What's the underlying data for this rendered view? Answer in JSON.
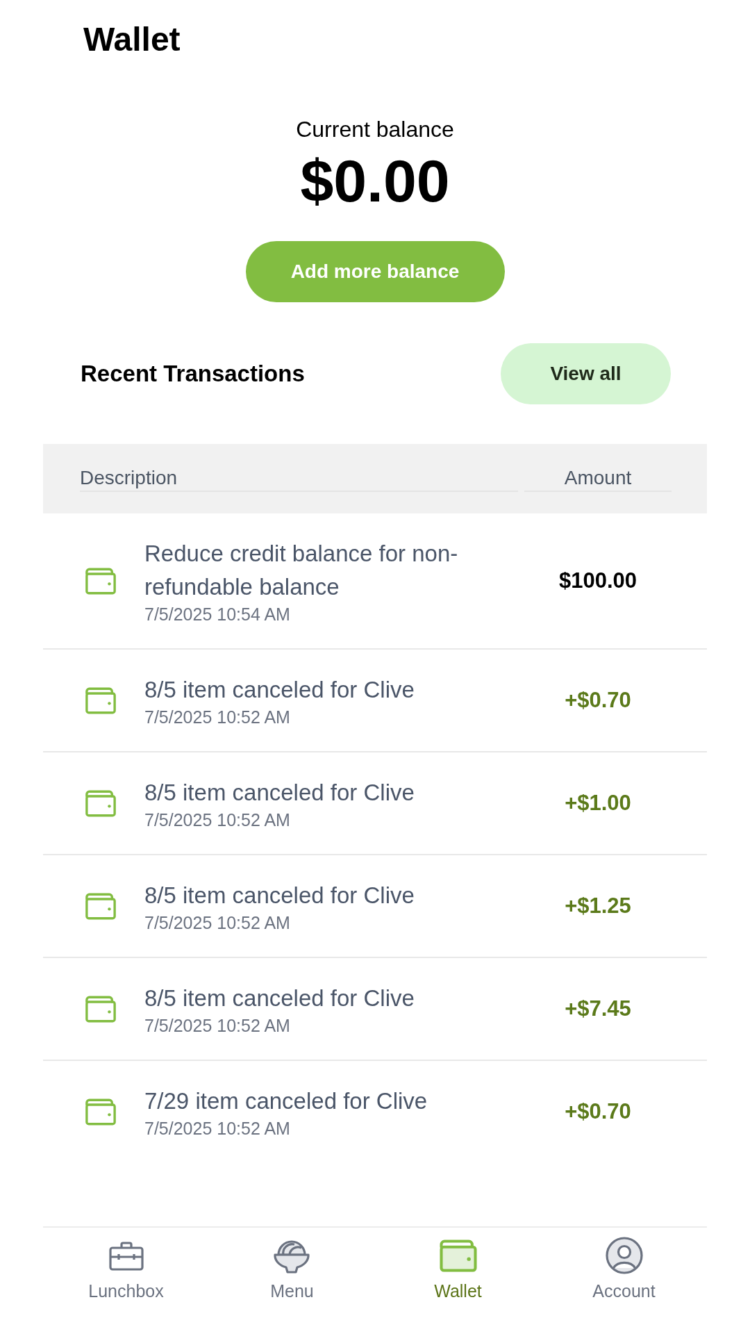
{
  "header": {
    "title": "Wallet"
  },
  "balance": {
    "label": "Current balance",
    "amount": "$0.00",
    "button": "Add more balance"
  },
  "transactions": {
    "title": "Recent Transactions",
    "view_all": "View all",
    "columns": [
      "Description",
      "Amount"
    ],
    "rows": [
      {
        "description": "Reduce credit balance for non-refundable balance",
        "date": "7/5/2025 10:54 AM",
        "amount": "$100.00",
        "kind": "debit"
      },
      {
        "description": "8/5 item canceled for Clive",
        "date": "7/5/2025 10:52 AM",
        "amount": "+$0.70",
        "kind": "credit"
      },
      {
        "description": "8/5 item canceled for Clive",
        "date": "7/5/2025 10:52 AM",
        "amount": "+$1.00",
        "kind": "credit"
      },
      {
        "description": "8/5 item canceled for Clive",
        "date": "7/5/2025 10:52 AM",
        "amount": "+$1.25",
        "kind": "credit"
      },
      {
        "description": "8/5 item canceled for Clive",
        "date": "7/5/2025 10:52 AM",
        "amount": "+$7.45",
        "kind": "credit"
      },
      {
        "description": "7/29 item canceled for Clive",
        "date": "7/5/2025 10:52 AM",
        "amount": "+$0.70",
        "kind": "credit"
      }
    ]
  },
  "nav": [
    {
      "label": "Lunchbox",
      "selected": false
    },
    {
      "label": "Menu",
      "selected": false
    },
    {
      "label": "Wallet",
      "selected": true
    },
    {
      "label": "Account",
      "selected": false
    }
  ]
}
